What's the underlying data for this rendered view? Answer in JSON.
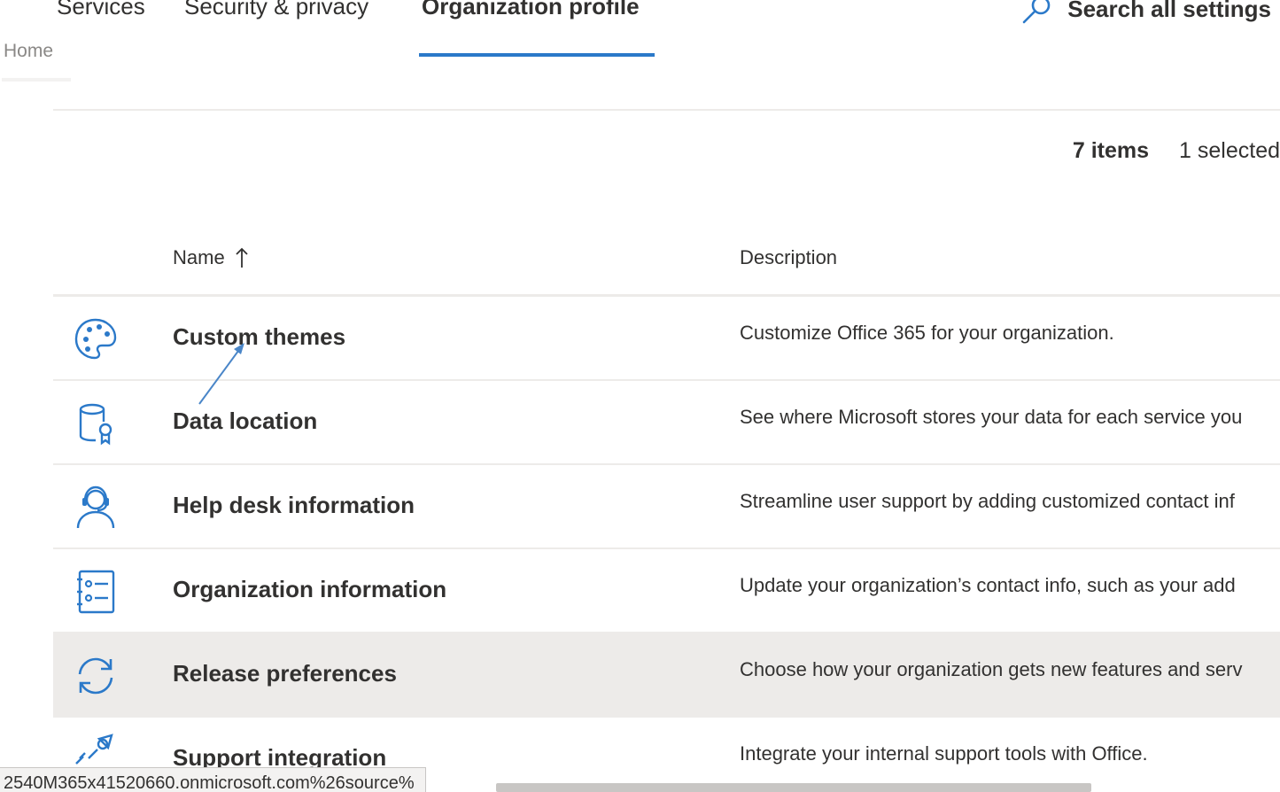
{
  "tabs": [
    {
      "label": "Services"
    },
    {
      "label": "Security & privacy"
    },
    {
      "label": "Organization profile",
      "active": true
    }
  ],
  "search": {
    "label": "Search all settings",
    "icon": "search-icon"
  },
  "home_link": "Home",
  "summary": {
    "count": "7 items",
    "selected": "1 selected"
  },
  "table": {
    "columns": [
      {
        "label": "Name",
        "sort": "ascending",
        "sort_icon": "sort-up-arrow-icon"
      },
      {
        "label": "Description"
      }
    ],
    "rows": [
      {
        "name": "Custom themes",
        "description": "Customize Office 365 for your organization.",
        "icon": "palette-icon"
      },
      {
        "name": "Data location",
        "description": "See where Microsoft stores your data for each service you",
        "icon": "database-location-icon"
      },
      {
        "name": "Help desk information",
        "description": "Streamline user support by adding customized contact inf",
        "icon": "headset-user-icon"
      },
      {
        "name": "Organization information",
        "description": "Update your organization’s contact info, such as your add",
        "icon": "contact-card-icon"
      },
      {
        "name": "Release preferences",
        "description": "Choose how your organization gets new features and serv",
        "icon": "sync-icon",
        "selected": true
      },
      {
        "name": "Support integration",
        "description": "Integrate your internal support tools with Office.",
        "icon": "integration-icon"
      }
    ]
  },
  "status_url": "2540M365x41520660.onmicrosoft.com%26source%",
  "colors": {
    "accent": "#2b79c9",
    "selected_row": "#edebe9",
    "divider": "#edebe9",
    "text": "#323130",
    "muted": "#8a8886"
  }
}
